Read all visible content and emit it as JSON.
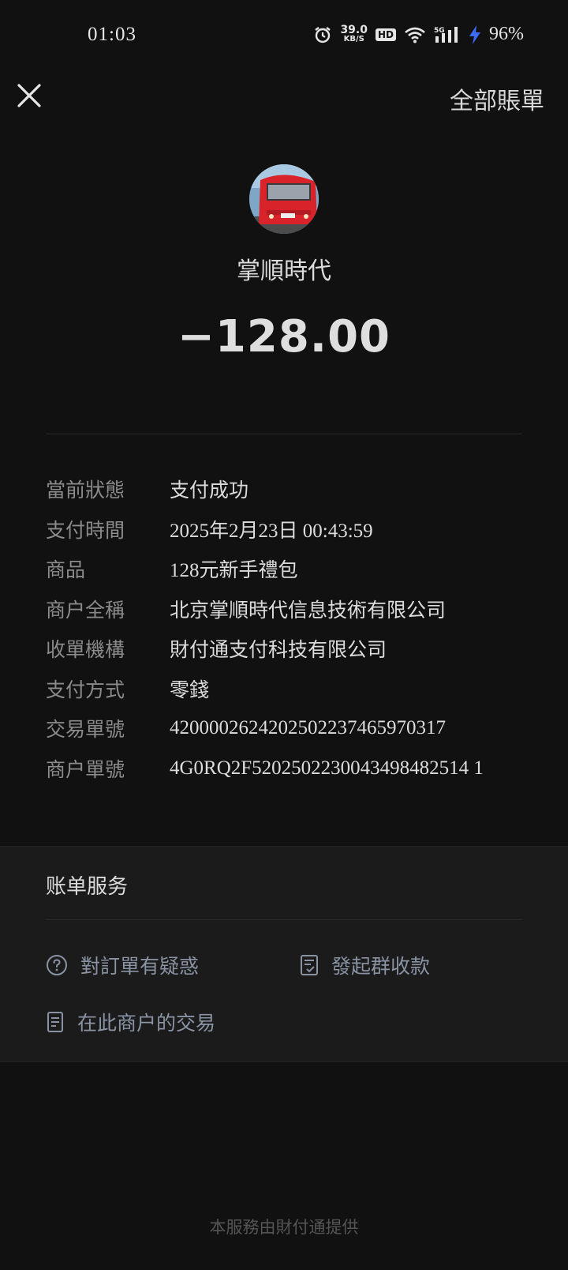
{
  "status_bar": {
    "time": "01:03",
    "net_speed_value": "39.0",
    "net_speed_unit": "KB/S",
    "hd_badge": "HD",
    "network": "5G",
    "battery": "96%",
    "icons": [
      "alarm-icon",
      "wifi-icon",
      "signal-icon",
      "charging-icon"
    ]
  },
  "header": {
    "close_icon": "close-icon",
    "all_bills_label": "全部賬單"
  },
  "merchant": {
    "avatar": "bus-avatar",
    "name": "掌順時代",
    "amount": "−128.00"
  },
  "details": [
    {
      "label": "當前狀態",
      "value": "支付成功"
    },
    {
      "label": "支付時間",
      "value": "2025年2月23日 00:43:59"
    },
    {
      "label": "商品",
      "value": "128元新手禮包"
    },
    {
      "label": "商户全稱",
      "value": "北京掌順時代信息技術有限公司"
    },
    {
      "label": "收單機構",
      "value": "財付通支付科技有限公司"
    },
    {
      "label": "支付方式",
      "value": "零錢"
    },
    {
      "label": "交易單號",
      "value": "4200002624202502237465970317"
    },
    {
      "label": "商户單號",
      "value": "4G0RQ2F5202502230043498482514 1"
    }
  ],
  "services": {
    "title": "账单服务",
    "items": [
      {
        "label": "對訂單有疑惑",
        "icon": "question-icon"
      },
      {
        "label": "發起群收款",
        "icon": "receipt-check-icon"
      },
      {
        "label": "在此商户的交易",
        "icon": "document-icon"
      }
    ]
  },
  "footer": {
    "text": "本服務由財付通提供"
  },
  "colors": {
    "background": "#111111",
    "panel": "#1b1b1b",
    "label_gray": "#8b8b8b",
    "link_blue_gray": "#8a93a3",
    "charging_blue": "#3d6bff"
  }
}
